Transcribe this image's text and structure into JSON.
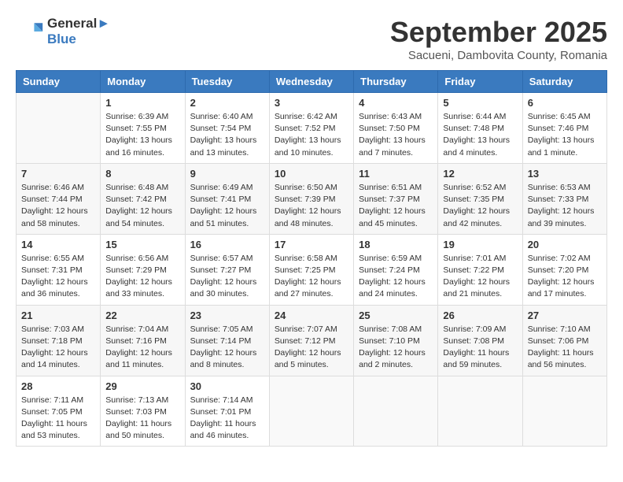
{
  "header": {
    "logo_line1": "General",
    "logo_line2": "Blue",
    "month_title": "September 2025",
    "subtitle": "Sacueni, Dambovita County, Romania"
  },
  "days_of_week": [
    "Sunday",
    "Monday",
    "Tuesday",
    "Wednesday",
    "Thursday",
    "Friday",
    "Saturday"
  ],
  "weeks": [
    [
      {
        "day": "",
        "sunrise": "",
        "sunset": "",
        "daylight": ""
      },
      {
        "day": "1",
        "sunrise": "Sunrise: 6:39 AM",
        "sunset": "Sunset: 7:55 PM",
        "daylight": "Daylight: 13 hours and 16 minutes."
      },
      {
        "day": "2",
        "sunrise": "Sunrise: 6:40 AM",
        "sunset": "Sunset: 7:54 PM",
        "daylight": "Daylight: 13 hours and 13 minutes."
      },
      {
        "day": "3",
        "sunrise": "Sunrise: 6:42 AM",
        "sunset": "Sunset: 7:52 PM",
        "daylight": "Daylight: 13 hours and 10 minutes."
      },
      {
        "day": "4",
        "sunrise": "Sunrise: 6:43 AM",
        "sunset": "Sunset: 7:50 PM",
        "daylight": "Daylight: 13 hours and 7 minutes."
      },
      {
        "day": "5",
        "sunrise": "Sunrise: 6:44 AM",
        "sunset": "Sunset: 7:48 PM",
        "daylight": "Daylight: 13 hours and 4 minutes."
      },
      {
        "day": "6",
        "sunrise": "Sunrise: 6:45 AM",
        "sunset": "Sunset: 7:46 PM",
        "daylight": "Daylight: 13 hours and 1 minute."
      }
    ],
    [
      {
        "day": "7",
        "sunrise": "Sunrise: 6:46 AM",
        "sunset": "Sunset: 7:44 PM",
        "daylight": "Daylight: 12 hours and 58 minutes."
      },
      {
        "day": "8",
        "sunrise": "Sunrise: 6:48 AM",
        "sunset": "Sunset: 7:42 PM",
        "daylight": "Daylight: 12 hours and 54 minutes."
      },
      {
        "day": "9",
        "sunrise": "Sunrise: 6:49 AM",
        "sunset": "Sunset: 7:41 PM",
        "daylight": "Daylight: 12 hours and 51 minutes."
      },
      {
        "day": "10",
        "sunrise": "Sunrise: 6:50 AM",
        "sunset": "Sunset: 7:39 PM",
        "daylight": "Daylight: 12 hours and 48 minutes."
      },
      {
        "day": "11",
        "sunrise": "Sunrise: 6:51 AM",
        "sunset": "Sunset: 7:37 PM",
        "daylight": "Daylight: 12 hours and 45 minutes."
      },
      {
        "day": "12",
        "sunrise": "Sunrise: 6:52 AM",
        "sunset": "Sunset: 7:35 PM",
        "daylight": "Daylight: 12 hours and 42 minutes."
      },
      {
        "day": "13",
        "sunrise": "Sunrise: 6:53 AM",
        "sunset": "Sunset: 7:33 PM",
        "daylight": "Daylight: 12 hours and 39 minutes."
      }
    ],
    [
      {
        "day": "14",
        "sunrise": "Sunrise: 6:55 AM",
        "sunset": "Sunset: 7:31 PM",
        "daylight": "Daylight: 12 hours and 36 minutes."
      },
      {
        "day": "15",
        "sunrise": "Sunrise: 6:56 AM",
        "sunset": "Sunset: 7:29 PM",
        "daylight": "Daylight: 12 hours and 33 minutes."
      },
      {
        "day": "16",
        "sunrise": "Sunrise: 6:57 AM",
        "sunset": "Sunset: 7:27 PM",
        "daylight": "Daylight: 12 hours and 30 minutes."
      },
      {
        "day": "17",
        "sunrise": "Sunrise: 6:58 AM",
        "sunset": "Sunset: 7:25 PM",
        "daylight": "Daylight: 12 hours and 27 minutes."
      },
      {
        "day": "18",
        "sunrise": "Sunrise: 6:59 AM",
        "sunset": "Sunset: 7:24 PM",
        "daylight": "Daylight: 12 hours and 24 minutes."
      },
      {
        "day": "19",
        "sunrise": "Sunrise: 7:01 AM",
        "sunset": "Sunset: 7:22 PM",
        "daylight": "Daylight: 12 hours and 21 minutes."
      },
      {
        "day": "20",
        "sunrise": "Sunrise: 7:02 AM",
        "sunset": "Sunset: 7:20 PM",
        "daylight": "Daylight: 12 hours and 17 minutes."
      }
    ],
    [
      {
        "day": "21",
        "sunrise": "Sunrise: 7:03 AM",
        "sunset": "Sunset: 7:18 PM",
        "daylight": "Daylight: 12 hours and 14 minutes."
      },
      {
        "day": "22",
        "sunrise": "Sunrise: 7:04 AM",
        "sunset": "Sunset: 7:16 PM",
        "daylight": "Daylight: 12 hours and 11 minutes."
      },
      {
        "day": "23",
        "sunrise": "Sunrise: 7:05 AM",
        "sunset": "Sunset: 7:14 PM",
        "daylight": "Daylight: 12 hours and 8 minutes."
      },
      {
        "day": "24",
        "sunrise": "Sunrise: 7:07 AM",
        "sunset": "Sunset: 7:12 PM",
        "daylight": "Daylight: 12 hours and 5 minutes."
      },
      {
        "day": "25",
        "sunrise": "Sunrise: 7:08 AM",
        "sunset": "Sunset: 7:10 PM",
        "daylight": "Daylight: 12 hours and 2 minutes."
      },
      {
        "day": "26",
        "sunrise": "Sunrise: 7:09 AM",
        "sunset": "Sunset: 7:08 PM",
        "daylight": "Daylight: 11 hours and 59 minutes."
      },
      {
        "day": "27",
        "sunrise": "Sunrise: 7:10 AM",
        "sunset": "Sunset: 7:06 PM",
        "daylight": "Daylight: 11 hours and 56 minutes."
      }
    ],
    [
      {
        "day": "28",
        "sunrise": "Sunrise: 7:11 AM",
        "sunset": "Sunset: 7:05 PM",
        "daylight": "Daylight: 11 hours and 53 minutes."
      },
      {
        "day": "29",
        "sunrise": "Sunrise: 7:13 AM",
        "sunset": "Sunset: 7:03 PM",
        "daylight": "Daylight: 11 hours and 50 minutes."
      },
      {
        "day": "30",
        "sunrise": "Sunrise: 7:14 AM",
        "sunset": "Sunset: 7:01 PM",
        "daylight": "Daylight: 11 hours and 46 minutes."
      },
      {
        "day": "",
        "sunrise": "",
        "sunset": "",
        "daylight": ""
      },
      {
        "day": "",
        "sunrise": "",
        "sunset": "",
        "daylight": ""
      },
      {
        "day": "",
        "sunrise": "",
        "sunset": "",
        "daylight": ""
      },
      {
        "day": "",
        "sunrise": "",
        "sunset": "",
        "daylight": ""
      }
    ]
  ]
}
